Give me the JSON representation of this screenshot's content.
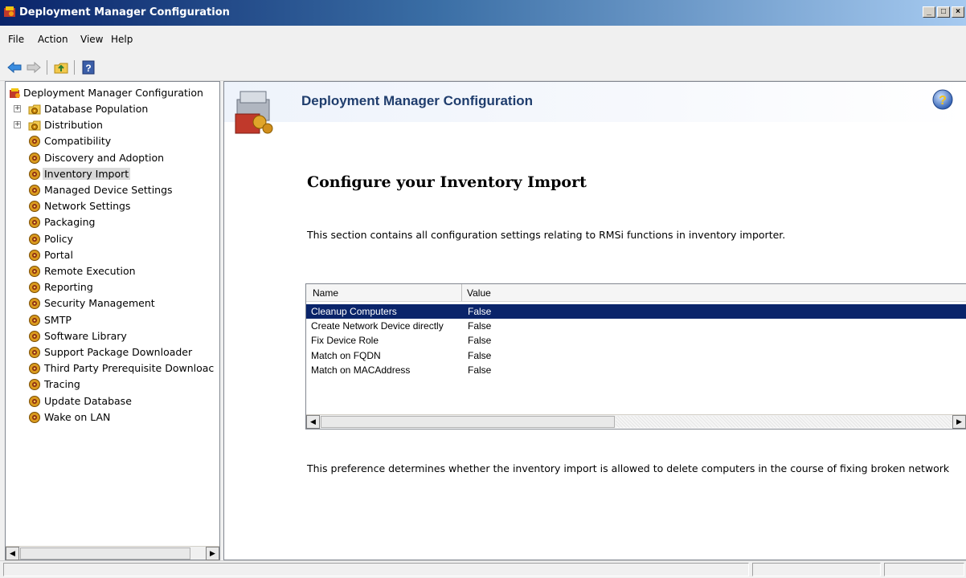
{
  "window": {
    "title": "Deployment Manager Configuration",
    "minimize": "_",
    "maximize": "□",
    "close": "×"
  },
  "menu": {
    "items": [
      "File",
      "Action",
      "View",
      "Help"
    ]
  },
  "toolbar": {
    "buttons": [
      "back-arrow-icon",
      "forward-arrow-icon",
      "up-folder-icon",
      "help-book-icon"
    ]
  },
  "tree": {
    "root": "Deployment Manager Configuration",
    "items": [
      {
        "label": "Database Population",
        "expandable": true
      },
      {
        "label": "Distribution",
        "expandable": true
      },
      {
        "label": "Compatibility"
      },
      {
        "label": "Discovery and Adoption"
      },
      {
        "label": "Inventory Import",
        "selected": true
      },
      {
        "label": "Managed Device Settings"
      },
      {
        "label": "Network Settings"
      },
      {
        "label": "Packaging"
      },
      {
        "label": "Policy"
      },
      {
        "label": "Portal"
      },
      {
        "label": "Remote Execution"
      },
      {
        "label": "Reporting"
      },
      {
        "label": "Security Management"
      },
      {
        "label": "SMTP"
      },
      {
        "label": "Software Library"
      },
      {
        "label": "Support Package Downloader"
      },
      {
        "label": "Third Party Prerequisite Downloac"
      },
      {
        "label": "Tracing"
      },
      {
        "label": "Update Database"
      },
      {
        "label": "Wake on LAN"
      }
    ]
  },
  "content": {
    "banner_title": "Deployment Manager Configuration",
    "heading": "Configure your Inventory Import",
    "description": "This section contains all configuration settings relating to RMSi functions in inventory importer.",
    "grid": {
      "columns": [
        "Name",
        "Value"
      ],
      "rows": [
        {
          "name": "Cleanup Computers",
          "value": "False",
          "selected": true
        },
        {
          "name": "Create Network Device directly",
          "value": "False"
        },
        {
          "name": "Fix Device Role",
          "value": "False"
        },
        {
          "name": "Match on FQDN",
          "value": "False"
        },
        {
          "name": "Match on MACAddress",
          "value": "False"
        }
      ]
    },
    "footer_description": "This preference determines whether the inventory import is allowed to delete computers in the course of fixing broken network"
  },
  "colors": {
    "selection": "#0a246a",
    "banner_title": "#1f3d6d"
  }
}
